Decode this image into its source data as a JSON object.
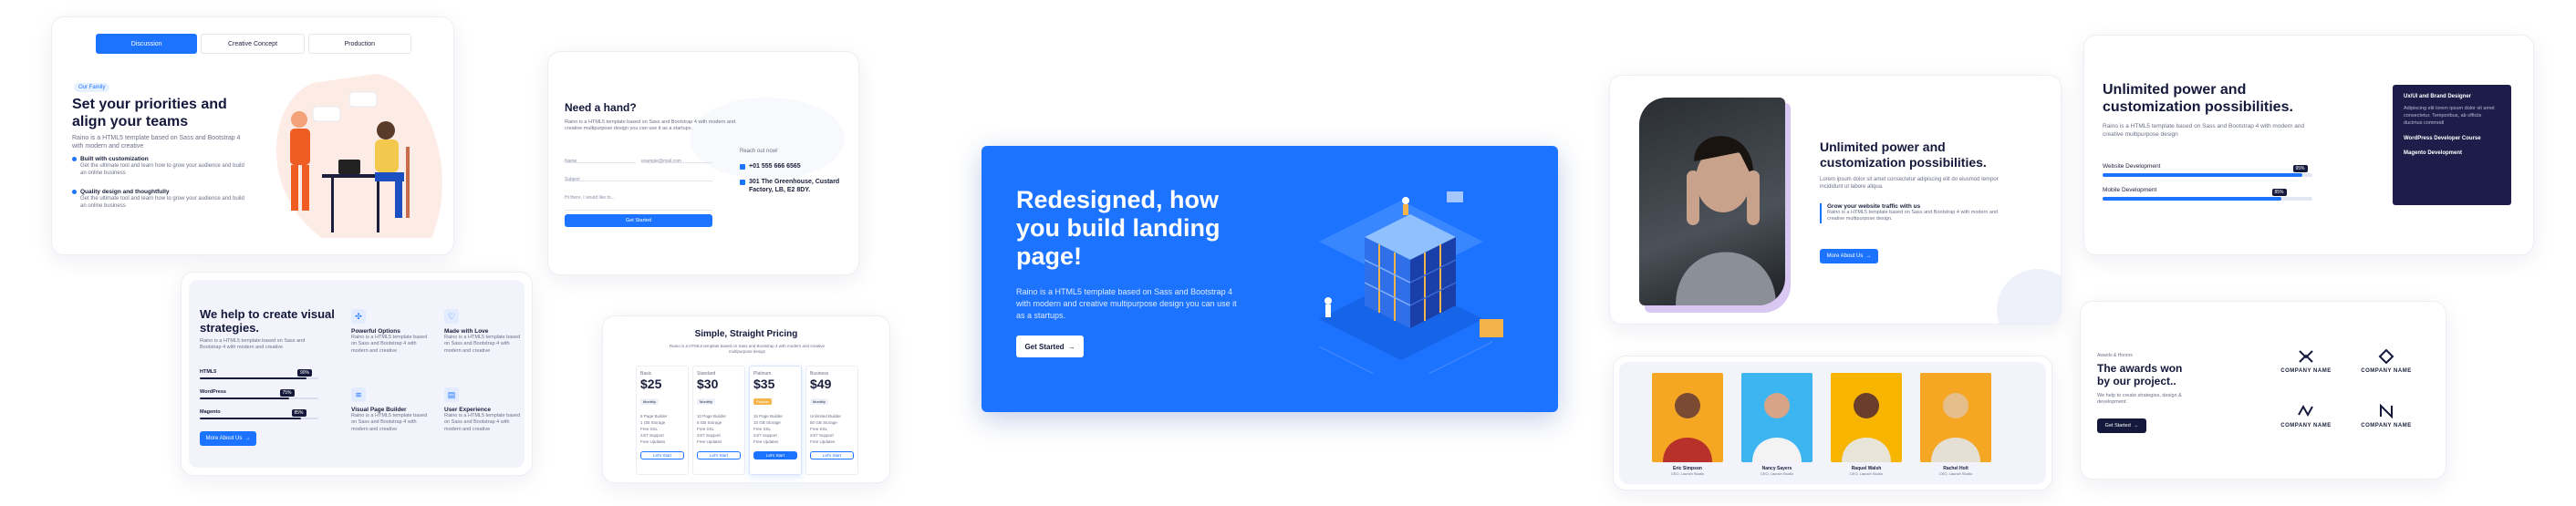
{
  "tabs_card": {
    "tabs": [
      "Discussion",
      "Creative Concept",
      "Production"
    ],
    "badge": "Our Family",
    "title": "Set your priorities and align your teams",
    "desc": "Raino is a HTML5 template based on Sass and Bootstrap 4 with modern and creative",
    "features": [
      {
        "title": "Built with customization",
        "text": "Get the ultimate tool and learn how to grow your audience and build an online business"
      },
      {
        "title": "Quality design and thoughtfully",
        "text": "Get the ultimate tool and learn how to grow your audience and build an online business"
      }
    ]
  },
  "contact_card": {
    "title": "Need a hand?",
    "desc": "Raino is a HTML5 template based on Sass and Bootstrap 4 with modern and creative multipurpose design you can use it as a startups.",
    "name_placeholder": "Name",
    "email_placeholder": "example@mail.com",
    "subject_placeholder": "Subject",
    "message_placeholder": "Hi there, I would like to...",
    "submit": "Get Started",
    "reach_title": "Reach out now!",
    "phone": "+01 555 666 6565",
    "address": "301 The Greenhouse, Custard Factory, LB, E2 8DY."
  },
  "hero": {
    "title": "Redesigned, how you build landing page!",
    "desc": "Raino is a HTML5 template based on Sass and Bootstrap 4 with modern and creative multipurpose design you can use it as a startups.",
    "cta": "Get Started",
    "colors": {
      "bg": "#1c73ff"
    }
  },
  "unlimited_card": {
    "title": "Unlimited power and customization possibilities.",
    "desc": "Lorem ipsum dolor sit amet consectetur adipiscing elit do eiusmod tempor incididunt ut labore aliqua.",
    "quote_title": "Grow your website traffic with us",
    "quote_text": "Raino is a HTML5 template based on Sass and Bootstrap 4 with modern and creative multipurpose design.",
    "cta": "More About Us"
  },
  "skills_card": {
    "title": "Unlimited power and customization possibilities.",
    "desc": "Raino is a HTML5 template based on Sass and Bootstrap 4 with modern and creative multipurpose design",
    "skills": [
      {
        "label": "Website Development",
        "value": 95,
        "pct": "95%"
      },
      {
        "label": "Mobile Development",
        "value": 85,
        "pct": "85%"
      }
    ],
    "panel": [
      {
        "title": "Ux/UI and Brand Designer",
        "text": "Adipiscing elit lorem ipsum dolor sit amet consectetur. Temporibus, ab officiis ducimus commodi"
      },
      {
        "title": "WordPress Developer Course",
        "text": ""
      },
      {
        "title": "Magento Development",
        "text": ""
      }
    ]
  },
  "strategy_card": {
    "title": "We help to create visual strategies.",
    "desc": "Raino is a HTML5 template based on Sass and Bootstrap 4 with modern and creative",
    "skills": [
      {
        "label": "HTML5",
        "value": 90,
        "pct": "90%"
      },
      {
        "label": "WordPress",
        "value": 75,
        "pct": "75%"
      },
      {
        "label": "Magento",
        "value": 85,
        "pct": "85%"
      }
    ],
    "cta": "More About Us",
    "features": [
      {
        "title": "Powerful Options",
        "text": "Raino is a HTML5 template based on Sass and Bootstrap 4 with modern and creative"
      },
      {
        "title": "Made with Love",
        "text": "Raino is a HTML5 template based on Sass and Bootstrap 4 with modern and creative"
      },
      {
        "title": "Visual Page Builder",
        "text": "Raino is a HTML5 template based on Sass and Bootstrap 4 with modern and creative"
      },
      {
        "title": "User Experience",
        "text": "Raino is a HTML5 template based on Sass and Bootstrap 4 with modern and creative"
      }
    ]
  },
  "pricing_card": {
    "title": "Simple, Straight Pricing",
    "desc": "Raino is a HTML5 template based on Sass and Bootstrap 4 with modern and creative multipurpose design",
    "plans": [
      {
        "name": "Basic",
        "price": "$25",
        "badge": "Monthly",
        "items": [
          "5 Page Builder",
          "1 GB Storage",
          "Free SSL",
          "24/7 Support",
          "Free Updates"
        ],
        "cta": "Let's Start"
      },
      {
        "name": "Standard",
        "price": "$30",
        "badge": "Monthly",
        "items": [
          "10 Page Builder",
          "5 GB Storage",
          "Free SSL",
          "24/7 Support",
          "Free Updates"
        ],
        "cta": "Let's Start"
      },
      {
        "name": "Platinum",
        "price": "$35",
        "badge": "Popular",
        "items": [
          "15 Page Builder",
          "10 GB Storage",
          "Free SSL",
          "24/7 Support",
          "Free Updates"
        ],
        "cta": "Let's Start"
      },
      {
        "name": "Business",
        "price": "$49",
        "badge": "Monthly",
        "items": [
          "Unlimited Builder",
          "50 GB Storage",
          "Free SSL",
          "24/7 Support",
          "Free Updates"
        ],
        "cta": "Let's Start"
      }
    ]
  },
  "team_card": {
    "members": [
      {
        "name": "Eric Simpson",
        "role": "CEO, Launch Studio",
        "bg": "#f5a623"
      },
      {
        "name": "Nancy Sayers",
        "role": "CEO, Launch Studio",
        "bg": "#3cb5f0"
      },
      {
        "name": "Raquel Walsh",
        "role": "CEO, Launch Studio",
        "bg": "#f7b500"
      },
      {
        "name": "Rachel Holt",
        "role": "CEO, Launch Studio",
        "bg": "#f5a623"
      }
    ]
  },
  "awards_card": {
    "badge": "Awards & Honors",
    "title": "The awards won by our project..",
    "desc": "We help to create strategies, design & development.",
    "cta": "Get Started",
    "logos": [
      "COMPANY NAME",
      "COMPANY NAME",
      "COMPANY NAME",
      "COMPANY NAME"
    ]
  }
}
